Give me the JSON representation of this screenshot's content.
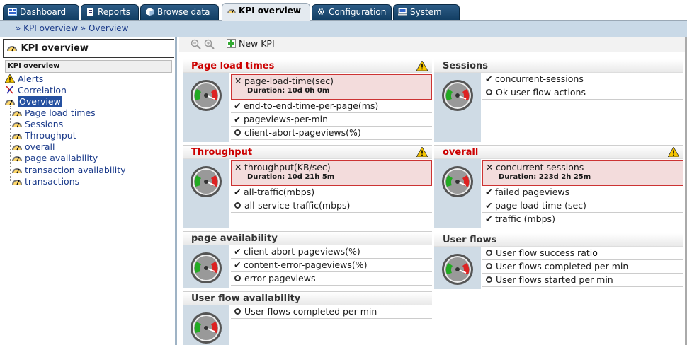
{
  "tabs": [
    {
      "label": "Dashboard",
      "icon": "dashboard-icon"
    },
    {
      "label": "Reports",
      "icon": "reports-icon"
    },
    {
      "label": "Browse data",
      "icon": "cube-icon"
    },
    {
      "label": "KPI overview",
      "icon": "gauge-icon",
      "active": true
    },
    {
      "label": "Configuration",
      "icon": "gear-icon"
    },
    {
      "label": "System",
      "icon": "computer-icon"
    }
  ],
  "breadcrumb": "» KPI overview » Overview",
  "sidebar": {
    "title": "KPI overview",
    "subheader": "KPI overview",
    "items": [
      {
        "label": "Alerts",
        "icon": "warning-icon"
      },
      {
        "label": "Correlation",
        "icon": "correlation-icon"
      },
      {
        "label": "Overview",
        "icon": "gauge-icon",
        "selected": true
      }
    ],
    "children": [
      "Page load times",
      "Sessions",
      "Throughput",
      "overall",
      "page availability",
      "transaction availability",
      "transactions"
    ]
  },
  "toolbar": {
    "new_kpi": "New KPI"
  },
  "panels": {
    "page_load_times": {
      "title": "Page load times",
      "alarm": {
        "name": "page-load-time(sec)",
        "duration": "Duration: 10d 0h 0m"
      },
      "rows": [
        "end-to-end-time-per-page(ms)",
        "pageviews-per-min",
        "client-abort-pageviews(%)"
      ]
    },
    "sessions": {
      "title": "Sessions",
      "rows": [
        "concurrent-sessions",
        "Ok user flow actions"
      ]
    },
    "throughput": {
      "title": "Throughput",
      "alarm": {
        "name": "throughput(KB/sec)",
        "duration": "Duration: 10d 21h 5m"
      },
      "rows": [
        "all-traffic(mbps)",
        "all-service-traffic(mbps)"
      ]
    },
    "overall": {
      "title": "overall",
      "alarm": {
        "name": "concurrent sessions",
        "duration": "Duration: 223d 2h 25m"
      },
      "rows": [
        "failed pageviews",
        "page load time (sec)",
        "traffic (mbps)"
      ]
    },
    "page_availability": {
      "title": "page availability",
      "rows": [
        "client-abort-pageviews(%)",
        "content-error-pageviews(%)",
        "error-pageviews"
      ]
    },
    "user_flows": {
      "title": "User flows",
      "rows": [
        "User flow success ratio",
        "User flows completed per min",
        "User flows started per min"
      ]
    },
    "user_flow_availability": {
      "title": "User flow availability",
      "rows": [
        "User flows completed per min"
      ]
    }
  },
  "colors": {
    "alarm": "#c00",
    "tab": "#1f4e79",
    "selected": "#2550a0"
  }
}
